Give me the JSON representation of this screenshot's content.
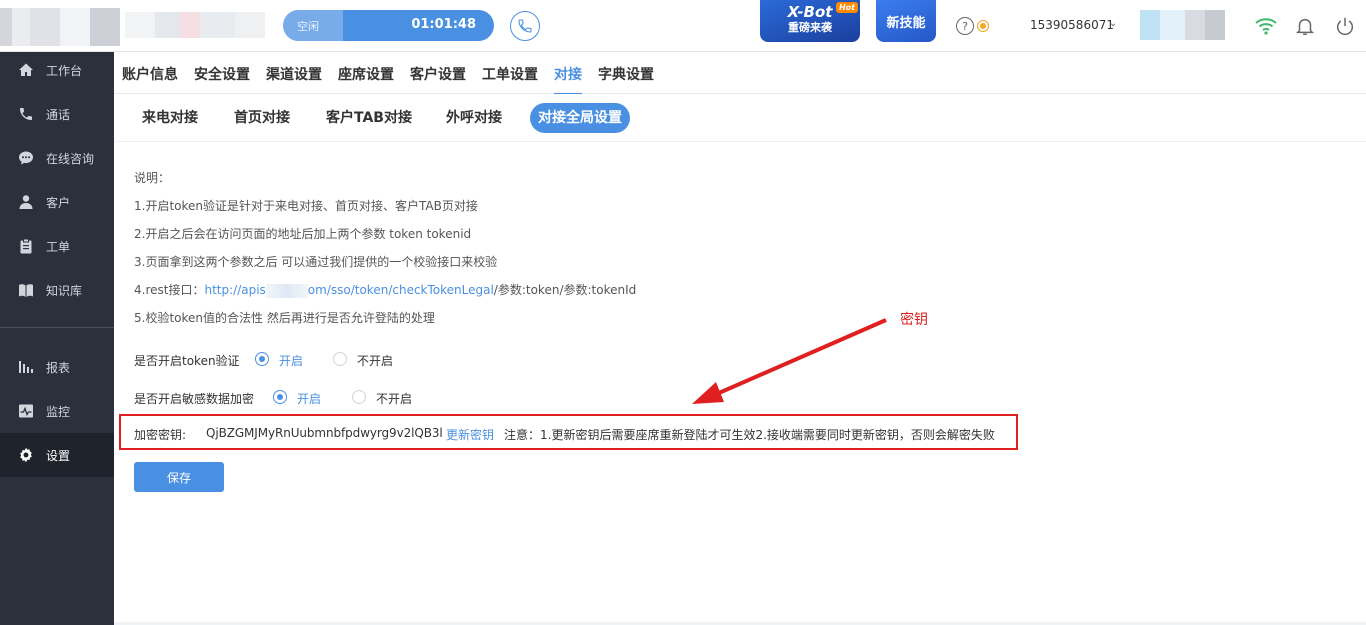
{
  "topbar": {
    "call_status": "空闲",
    "call_timer": "01:01:48",
    "xbot_title": "X-Bot",
    "xbot_subtitle": "重磅来袭",
    "xbot_badge": "Hot",
    "new_skill": "新技能",
    "user_phone": "15390586071",
    "accent": "#4a90e2"
  },
  "sidebar": {
    "items": [
      {
        "label": "工作台",
        "icon": "home-icon"
      },
      {
        "label": "通话",
        "icon": "phone-icon"
      },
      {
        "label": "在线咨询",
        "icon": "chat-icon"
      },
      {
        "label": "客户",
        "icon": "user-icon"
      },
      {
        "label": "工单",
        "icon": "clipboard-icon"
      },
      {
        "label": "知识库",
        "icon": "book-icon"
      },
      {
        "label": "报表",
        "icon": "bar-chart-icon"
      },
      {
        "label": "监控",
        "icon": "monitor-icon"
      },
      {
        "label": "设置",
        "icon": "gear-icon",
        "active": true
      }
    ]
  },
  "tabs_main": [
    "账户信息",
    "安全设置",
    "渠道设置",
    "座席设置",
    "客户设置",
    "工单设置",
    "对接",
    "字典设置"
  ],
  "tabs_sub": [
    "来电对接",
    "首页对接",
    "客户TAB对接",
    "外呼对接",
    "对接全局设置"
  ],
  "content": {
    "desc_title": "说明：",
    "desc_1": "1.开启token验证是针对于来电对接、首页对接、客户TAB页对接",
    "desc_2": "2.开启之后会在访问页面的地址后加上两个参数 token tokenid",
    "desc_3": "3.页面拿到这两个参数之后 可以通过我们提供的一个校验接口来校验",
    "desc_4_prefix": "4.rest接口：",
    "desc_4_link_a": "http://apis",
    "desc_4_link_b": "om/sso/token/checkTokenLegal",
    "desc_4_suffix": "/参数:token/参数:tokenId",
    "desc_5": "5.校验token值的合法性 然后再进行是否允许登陆的处理",
    "token_label": "是否开启token验证",
    "token_on": "开启",
    "token_off": "不开启",
    "encrypt_label": "是否开启敏感数据加密",
    "encrypt_on": "开启",
    "encrypt_off": "不开启",
    "key_label": "加密密钥:",
    "key_value": "QjBZGMJMyRnUubmnbfpdwyrg9v2lQB3l",
    "key_update": "更新密钥",
    "key_note": "注意：1.更新密钥后需要座席重新登陆才可生效2.接收端需要同时更新密钥，否则会解密失败",
    "save": "保存"
  },
  "annotation": {
    "text": "密钥",
    "color": "#e02020"
  }
}
